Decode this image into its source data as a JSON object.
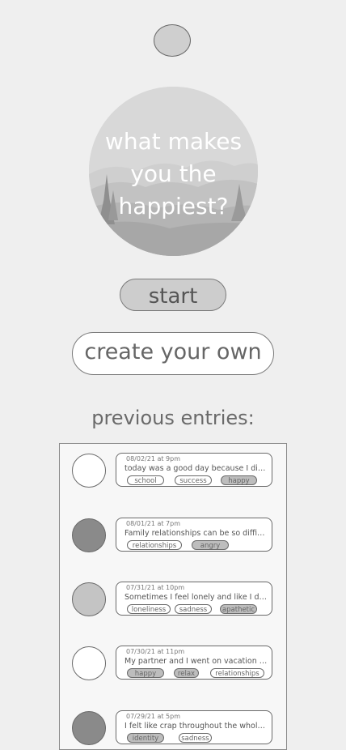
{
  "prompt": {
    "line1": "what makes",
    "line2": "you the",
    "line3": "happiest?"
  },
  "buttons": {
    "start": "start",
    "create": "create your own"
  },
  "entries_title": "previous entries:",
  "entries": [
    {
      "mood_color": "#ffffff",
      "date": "08/02/21 at 9pm",
      "text": "today was a good day because I did well in",
      "tags": [
        {
          "label": "school",
          "filled": false
        },
        {
          "label": "success",
          "filled": false
        },
        {
          "label": "happy",
          "filled": true
        }
      ]
    },
    {
      "mood_color": "#8a8a8a",
      "date": "08/01/21 at 7pm",
      "text": "Family relationships can be so difficult sometimes",
      "tags": [
        {
          "label": "relationships",
          "filled": false
        },
        {
          "label": "angry",
          "filled": true
        }
      ]
    },
    {
      "mood_color": "#c4c4c4",
      "date": "07/31/21 at 10pm",
      "text": "Sometimes I feel lonely and like I don't belong",
      "tags": [
        {
          "label": "loneliness",
          "filled": false
        },
        {
          "label": "sadness",
          "filled": false
        },
        {
          "label": "apathetic",
          "filled": true
        }
      ]
    },
    {
      "mood_color": "#ffffff",
      "date": "07/30/21 at 11pm",
      "text": "My partner and I went on vacation and it was",
      "tags": [
        {
          "label": "happy",
          "filled": true
        },
        {
          "label": "relax",
          "filled": true
        },
        {
          "label": "relationships",
          "filled": false
        }
      ]
    },
    {
      "mood_color": "#8a8a8a",
      "date": "07/29/21 at 5pm",
      "text": "I felt like crap throughout the whole day today",
      "tags": [
        {
          "label": "identity",
          "filled": true
        },
        {
          "label": "sadness",
          "filled": false
        }
      ]
    }
  ]
}
